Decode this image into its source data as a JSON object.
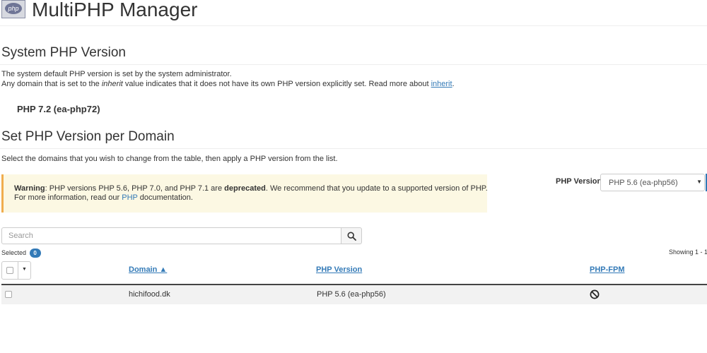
{
  "header": {
    "icon_text": "php",
    "title": "MultiPHP Manager"
  },
  "system_section": {
    "heading": "System PHP Version",
    "line1": "The system default PHP version is set by the system administrator.",
    "line2_prefix": "Any domain that is set to the ",
    "line2_italic": "inherit",
    "line2_middle": " value indicates that it does not have its own PHP version explicitly set. Read more about ",
    "line2_link": "inherit",
    "line2_suffix": ".",
    "current_version": "PHP 7.2 (ea-php72)"
  },
  "domain_section": {
    "heading": "Set PHP Version per Domain",
    "instructions": "Select the domains that you wish to change from the table, then apply a PHP version from the list."
  },
  "warning": {
    "label": "Warning",
    "text_a": ": PHP versions PHP 5.6, PHP 7.0, and PHP 7.1 are ",
    "text_bold": "deprecated",
    "text_b": ". We recommend that you update to a supported version of PHP.",
    "line2_prefix": "For more information, read our ",
    "line2_link": "PHP",
    "line2_suffix": " documentation.",
    "accent_color": "#f0ad4e",
    "background_color": "#fcf8e3"
  },
  "php_version_select": {
    "label": "PHP Version",
    "selected": "PHP 5.6 (ea-php56)",
    "caret": "▼"
  },
  "search": {
    "placeholder": "Search",
    "icon": "search-icon"
  },
  "selection": {
    "label": "Selected",
    "count": "0",
    "showing": "Showing 1 - 1"
  },
  "table": {
    "columns": {
      "domain": "Domain ▲",
      "php_version": "PHP Version",
      "php_fpm": "PHP-FPM"
    },
    "bulk_caret": "▼",
    "rows": [
      {
        "domain": "hichifood.dk",
        "php_version": "PHP 5.6 (ea-php56)",
        "php_fpm_icon": "prohibited-icon"
      }
    ]
  },
  "colors": {
    "link": "#337ab7",
    "badge": "#337ab7",
    "row_background": "#f2f2f2"
  }
}
